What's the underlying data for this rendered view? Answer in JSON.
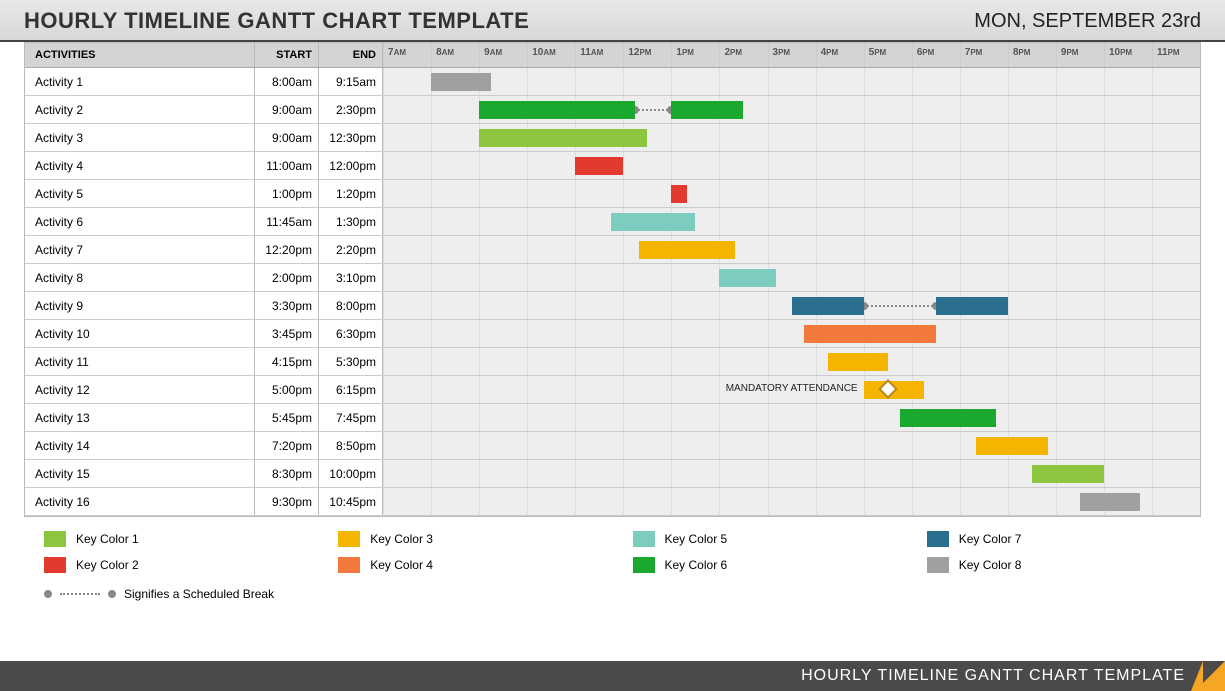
{
  "header": {
    "title": "HOURLY TIMELINE GANTT CHART TEMPLATE",
    "date": "MON, SEPTEMBER 23rd"
  },
  "columns": {
    "activities": "ACTIVITIES",
    "start": "START",
    "end": "END"
  },
  "axis": {
    "startHour": 7,
    "endHour": 23,
    "labels": [
      "7AM",
      "8AM",
      "9AM",
      "10AM",
      "11AM",
      "12PM",
      "1PM",
      "2PM",
      "3PM",
      "4PM",
      "5PM",
      "6PM",
      "7PM",
      "8PM",
      "9PM",
      "10PM",
      "11PM"
    ]
  },
  "colors": {
    "c1": "#8cc63f",
    "c2": "#e13a2e",
    "c3": "#f4b400",
    "c4": "#f2783c",
    "c5": "#7dccc0",
    "c6": "#1aa92e",
    "c7": "#2a6f8e",
    "c8": "#a0a0a0"
  },
  "legend": [
    {
      "label": "Key Color 1",
      "color": "c1"
    },
    {
      "label": "Key Color 3",
      "color": "c3"
    },
    {
      "label": "Key Color 5",
      "color": "c5"
    },
    {
      "label": "Key Color 7",
      "color": "c7"
    },
    {
      "label": "Key Color 2",
      "color": "c2"
    },
    {
      "label": "Key Color 4",
      "color": "c4"
    },
    {
      "label": "Key Color 6",
      "color": "c6"
    },
    {
      "label": "Key Color 8",
      "color": "c8"
    }
  ],
  "break_legend": "Signifies a Scheduled Break",
  "footer": "HOURLY TIMELINE GANTT CHART TEMPLATE",
  "chart_data": {
    "type": "gantt",
    "x_unit": "hour_of_day",
    "x_range": [
      7,
      24
    ],
    "activities": [
      {
        "name": "Activity 1",
        "start": "8:00am",
        "end": "9:15am",
        "segments": [
          {
            "from": 8.0,
            "to": 9.25,
            "color": "c8"
          }
        ]
      },
      {
        "name": "Activity 2",
        "start": "9:00am",
        "end": "2:30pm",
        "segments": [
          {
            "from": 9.0,
            "to": 12.25,
            "color": "c6"
          },
          {
            "from": 13.0,
            "to": 14.5,
            "color": "c6"
          }
        ],
        "break": {
          "from": 12.25,
          "to": 13.0
        }
      },
      {
        "name": "Activity 3",
        "start": "9:00am",
        "end": "12:30pm",
        "segments": [
          {
            "from": 9.0,
            "to": 12.5,
            "color": "c1"
          }
        ]
      },
      {
        "name": "Activity 4",
        "start": "11:00am",
        "end": "12:00pm",
        "segments": [
          {
            "from": 11.0,
            "to": 12.0,
            "color": "c2"
          }
        ]
      },
      {
        "name": "Activity 5",
        "start": "1:00pm",
        "end": "1:20pm",
        "segments": [
          {
            "from": 13.0,
            "to": 13.33,
            "color": "c2"
          }
        ]
      },
      {
        "name": "Activity 6",
        "start": "11:45am",
        "end": "1:30pm",
        "segments": [
          {
            "from": 11.75,
            "to": 13.5,
            "color": "c5"
          }
        ]
      },
      {
        "name": "Activity 7",
        "start": "12:20pm",
        "end": "2:20pm",
        "segments": [
          {
            "from": 12.33,
            "to": 14.33,
            "color": "c3"
          }
        ]
      },
      {
        "name": "Activity 8",
        "start": "2:00pm",
        "end": "3:10pm",
        "segments": [
          {
            "from": 14.0,
            "to": 15.17,
            "color": "c5"
          }
        ]
      },
      {
        "name": "Activity 9",
        "start": "3:30pm",
        "end": "8:00pm",
        "segments": [
          {
            "from": 15.5,
            "to": 17.0,
            "color": "c7"
          },
          {
            "from": 18.5,
            "to": 20.0,
            "color": "c7"
          }
        ],
        "break": {
          "from": 17.0,
          "to": 18.5
        }
      },
      {
        "name": "Activity 10",
        "start": "3:45pm",
        "end": "6:30pm",
        "segments": [
          {
            "from": 15.75,
            "to": 18.5,
            "color": "c4"
          }
        ]
      },
      {
        "name": "Activity 11",
        "start": "4:15pm",
        "end": "5:30pm",
        "segments": [
          {
            "from": 16.25,
            "to": 17.5,
            "color": "c3"
          }
        ]
      },
      {
        "name": "Activity 12",
        "start": "5:00pm",
        "end": "6:15pm",
        "segments": [
          {
            "from": 17.0,
            "to": 18.25,
            "color": "c3"
          }
        ],
        "annotation": "MANDATORY ATTENDANCE",
        "milestone": 17.5
      },
      {
        "name": "Activity 13",
        "start": "5:45pm",
        "end": "7:45pm",
        "segments": [
          {
            "from": 17.75,
            "to": 19.75,
            "color": "c6"
          }
        ]
      },
      {
        "name": "Activity 14",
        "start": "7:20pm",
        "end": "8:50pm",
        "segments": [
          {
            "from": 19.33,
            "to": 20.83,
            "color": "c3"
          }
        ]
      },
      {
        "name": "Activity 15",
        "start": "8:30pm",
        "end": "10:00pm",
        "segments": [
          {
            "from": 20.5,
            "to": 22.0,
            "color": "c1"
          }
        ]
      },
      {
        "name": "Activity 16",
        "start": "9:30pm",
        "end": "10:45pm",
        "segments": [
          {
            "from": 21.5,
            "to": 22.75,
            "color": "c8"
          }
        ]
      }
    ]
  }
}
